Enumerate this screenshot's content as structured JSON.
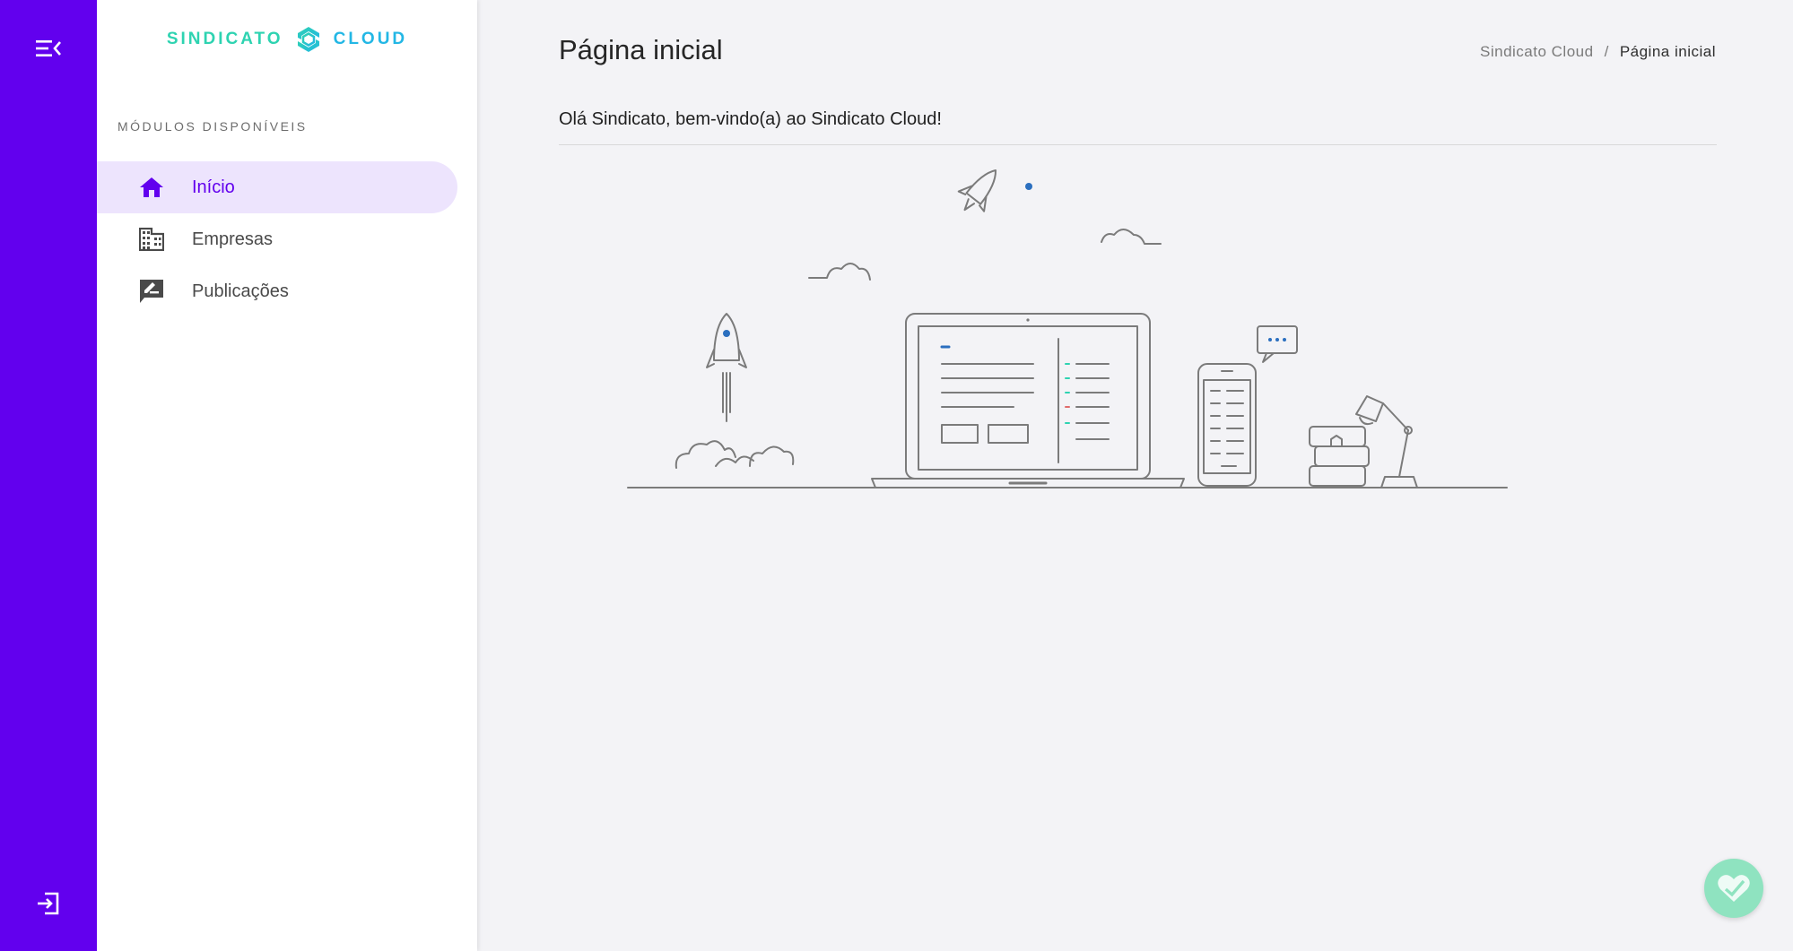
{
  "rail": {
    "menu_icon": "menu-collapse-icon",
    "logout_icon": "logout-icon"
  },
  "brand": {
    "left": "SINDICATO",
    "right": "CLOUD",
    "left_color": "#2ed3b1",
    "right_color": "#23b7e5"
  },
  "sidebar": {
    "section_title": "MÓDULOS DISPONÍVEIS",
    "items": [
      {
        "label": "Início",
        "icon": "home-icon",
        "active": true
      },
      {
        "label": "Empresas",
        "icon": "building-icon",
        "active": false
      },
      {
        "label": "Publicações",
        "icon": "publication-icon",
        "active": false
      }
    ]
  },
  "header": {
    "title": "Página inicial",
    "breadcrumb": [
      "Sindicato Cloud",
      "Página inicial"
    ],
    "breadcrumb_separator": "/"
  },
  "main": {
    "welcome": "Olá Sindicato, bem-vindo(a) ao Sindicato Cloud!"
  },
  "colors": {
    "primary": "#6200ee",
    "active_bg": "#ede4fd",
    "background": "#f3f3f6",
    "fab": "#8fe3c0"
  },
  "fab": {
    "icon": "healthy-check-icon"
  }
}
